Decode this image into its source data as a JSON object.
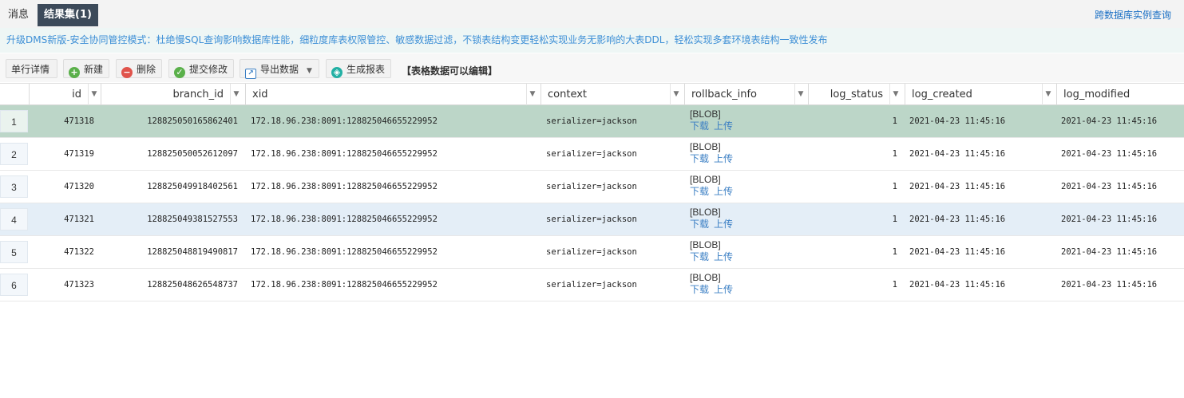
{
  "tabs": [
    {
      "label": "消息"
    },
    {
      "label": "结果集(1)"
    }
  ],
  "cross_db_link": "跨数据库实例查询",
  "banner": "升级DMS新版-安全协同管控模式：杜绝慢SQL查询影响数据库性能，细粒度库表权限管控、敏感数据过滤，不锁表结构变更轻松实现业务无影响的大表DDL，轻松实现多套环境表结构一致性发布",
  "toolbar": {
    "detail": "单行详情",
    "new": "新建",
    "delete": "删除",
    "commit": "提交修改",
    "export": "导出数据",
    "report": "生成报表",
    "note": "【表格数据可以编辑】"
  },
  "columns": [
    "id",
    "branch_id",
    "xid",
    "context",
    "rollback_info",
    "log_status",
    "log_created",
    "log_modified"
  ],
  "blob_label": "[BLOB]",
  "download": "下载",
  "upload": "上传",
  "rows": [
    {
      "n": "1",
      "id": "471318",
      "branch_id": "128825050165862401",
      "xid": "172.18.96.238:8091:128825046655229952",
      "context": "serializer=jackson",
      "log_status": "1",
      "log_created": "2021-04-23 11:45:16",
      "log_modified": "2021-04-23 11:45:16"
    },
    {
      "n": "2",
      "id": "471319",
      "branch_id": "128825050052612097",
      "xid": "172.18.96.238:8091:128825046655229952",
      "context": "serializer=jackson",
      "log_status": "1",
      "log_created": "2021-04-23 11:45:16",
      "log_modified": "2021-04-23 11:45:16"
    },
    {
      "n": "3",
      "id": "471320",
      "branch_id": "128825049918402561",
      "xid": "172.18.96.238:8091:128825046655229952",
      "context": "serializer=jackson",
      "log_status": "1",
      "log_created": "2021-04-23 11:45:16",
      "log_modified": "2021-04-23 11:45:16"
    },
    {
      "n": "4",
      "id": "471321",
      "branch_id": "128825049381527553",
      "xid": "172.18.96.238:8091:128825046655229952",
      "context": "serializer=jackson",
      "log_status": "1",
      "log_created": "2021-04-23 11:45:16",
      "log_modified": "2021-04-23 11:45:16"
    },
    {
      "n": "5",
      "id": "471322",
      "branch_id": "128825048819490817",
      "xid": "172.18.96.238:8091:128825046655229952",
      "context": "serializer=jackson",
      "log_status": "1",
      "log_created": "2021-04-23 11:45:16",
      "log_modified": "2021-04-23 11:45:16"
    },
    {
      "n": "6",
      "id": "471323",
      "branch_id": "128825048626548737",
      "xid": "172.18.96.238:8091:128825046655229952",
      "context": "serializer=jackson",
      "log_status": "1",
      "log_created": "2021-04-23 11:45:16",
      "log_modified": "2021-04-23 11:45:16"
    }
  ],
  "selected_row": 0,
  "highlighted_row": 3,
  "colors": {
    "selected_row": "#bcd6c8",
    "highlight_row": "#e4eef7",
    "active_tab": "#3c4a5a",
    "link": "#1a6fc4",
    "banner_text": "#3d8fd6"
  }
}
